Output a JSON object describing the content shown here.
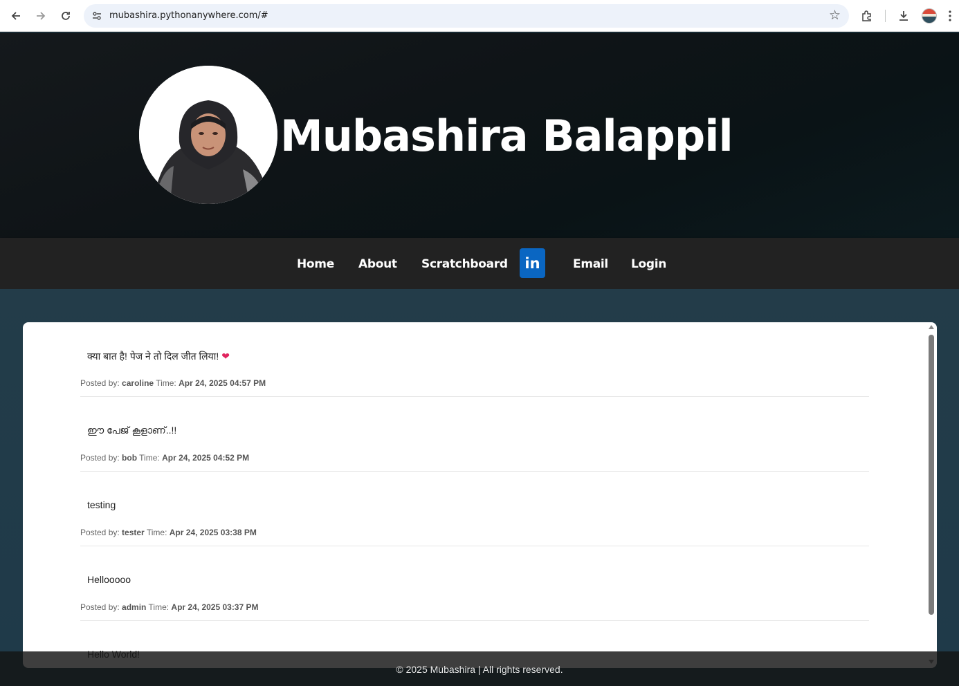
{
  "browser": {
    "url": "mubashira.pythonanywhere.com/#",
    "back_icon": "arrow-left-icon",
    "forward_icon": "arrow-right-icon",
    "reload_icon": "reload-icon"
  },
  "header": {
    "title": "Mubashira Balappil"
  },
  "nav": {
    "items": [
      {
        "label": "Home"
      },
      {
        "label": "About"
      },
      {
        "label": "Scratchboard"
      },
      {
        "label": "in"
      },
      {
        "label": "Email"
      },
      {
        "label": "Login"
      }
    ]
  },
  "posts": [
    {
      "message": "क्या बात है! पेज ने तो दिल जीत लिया!",
      "posted_by_label": "Posted by:",
      "author": "caroline",
      "time_label": "Time:",
      "time": "Apr 24, 2025 04:57 PM"
    },
    {
      "message": "ഈ പേജ് കൂളാണ്..!!",
      "posted_by_label": "Posted by:",
      "author": "bob",
      "time_label": "Time:",
      "time": "Apr 24, 2025 04:52 PM"
    },
    {
      "message": "testing",
      "posted_by_label": "Posted by:",
      "author": "tester",
      "time_label": "Time:",
      "time": "Apr 24, 2025 03:38 PM"
    },
    {
      "message": "Hellooooo",
      "posted_by_label": "Posted by:",
      "author": "admin",
      "time_label": "Time:",
      "time": "Apr 24, 2025 03:37 PM"
    },
    {
      "message": "Hello World!"
    }
  ],
  "footer": {
    "text": "© 2025 Mubashira | All rights reserved."
  },
  "colors": {
    "linkedin": "#0a66c2",
    "navbar": "#222222",
    "heart": "#e0245e"
  }
}
